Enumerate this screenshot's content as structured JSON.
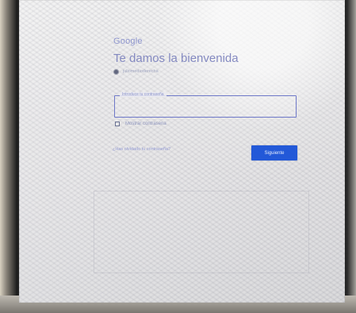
{
  "page": {
    "brand": "Google",
    "title": "Te damos la bienvenida",
    "account_email": "juliomedioderecha",
    "password_label": "Introduce tu contraseña",
    "password_value": "",
    "show_password_label": "Mostrar contraseña",
    "forgot_password_link": "¿Has olvidado tu contraseña?",
    "next_button": "Siguiente"
  },
  "colors": {
    "accent": "#1952d8",
    "text_blue": "#7f85bf",
    "field_border": "#6e78c8"
  },
  "icons": {
    "account": "account-circle-icon",
    "checkbox": "checkbox-icon"
  }
}
